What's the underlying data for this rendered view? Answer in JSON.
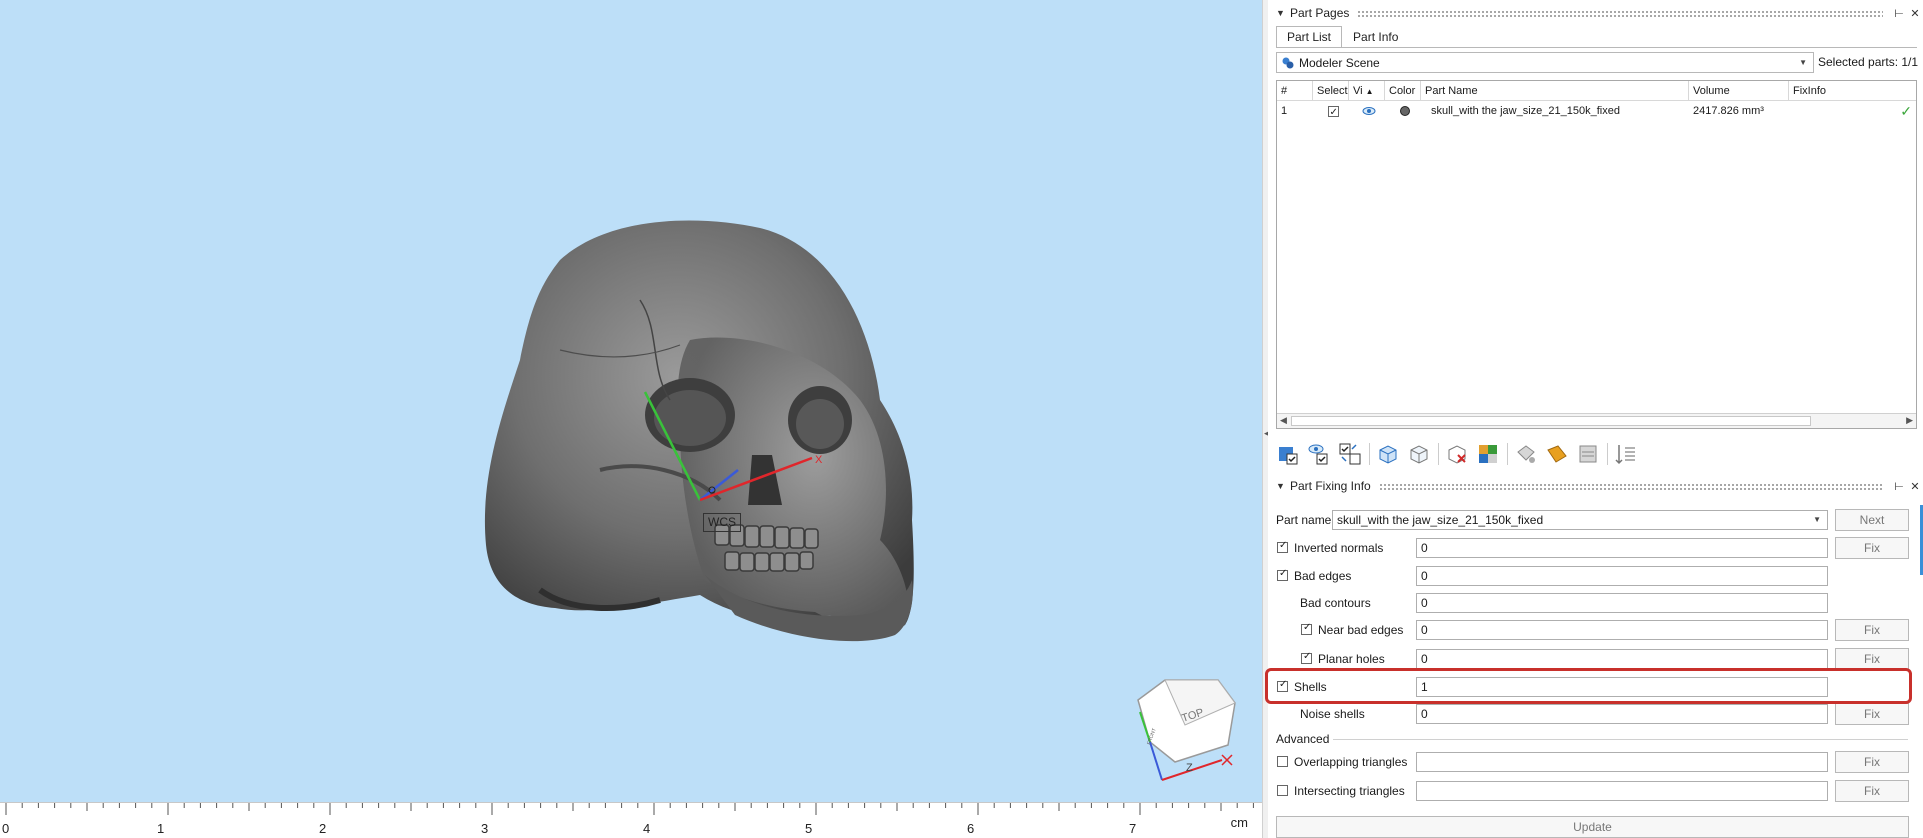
{
  "viewport": {
    "wcs_label": "WCS",
    "axis_x_label": "X",
    "viewcube_face": "TOP",
    "viewcube_z": "Z",
    "ruler_labels": [
      "0",
      "1",
      "2",
      "3",
      "4",
      "5",
      "6",
      "7"
    ],
    "ruler_unit": "cm",
    "background_color": "#bddff8"
  },
  "part_pages": {
    "title": "Part Pages",
    "tabs": [
      {
        "label": "Part List",
        "active": true
      },
      {
        "label": "Part Info",
        "active": false
      }
    ],
    "scene_select": "Modeler Scene",
    "selected_parts": "Selected parts: 1/1",
    "table": {
      "columns": [
        "#",
        "Select",
        "Vi",
        "Color",
        "Part Name",
        "Volume",
        "FixInfo"
      ],
      "rows": [
        {
          "num": "1",
          "selected": true,
          "visible": true,
          "color": "#666666",
          "name": "skull_with the jaw_size_21_150k_fixed",
          "volume": "2417.826 mm³",
          "fixinfo_ok": true
        }
      ]
    },
    "toolbar_icons": [
      "select-all-icon",
      "toggle-visibility-icon",
      "invert-selection-icon",
      "group-parts-icon",
      "ungroup-parts-icon",
      "delete-part-icon",
      "merge-parts-icon",
      "duplicate-part-icon",
      "label-icon",
      "layers-icon",
      "sort-list-icon"
    ]
  },
  "part_fixing": {
    "title": "Part Fixing Info",
    "part_name_label": "Part name",
    "part_name_value": "skull_with the jaw_size_21_150k_fixed",
    "next_label": "Next",
    "fix_label": "Fix",
    "advanced_label": "Advanced",
    "update_label": "Update",
    "rows": {
      "inverted_normals": {
        "label": "Inverted normals",
        "value": "0",
        "checked": true
      },
      "bad_edges": {
        "label": "Bad edges",
        "value": "0",
        "checked": true
      },
      "bad_contours": {
        "label": "Bad contours",
        "value": "0"
      },
      "near_bad_edges": {
        "label": "Near bad edges",
        "value": "0",
        "checked": true
      },
      "planar_holes": {
        "label": "Planar holes",
        "value": "0",
        "checked": true
      },
      "shells": {
        "label": "Shells",
        "value": "1",
        "checked": true
      },
      "noise_shells": {
        "label": "Noise shells",
        "value": "0"
      },
      "overlapping_triangles": {
        "label": "Overlapping triangles",
        "value": "",
        "checked": false
      },
      "intersecting_triangles": {
        "label": "Intersecting triangles",
        "value": "",
        "checked": false
      }
    },
    "highlight_color": "#c8302b"
  }
}
